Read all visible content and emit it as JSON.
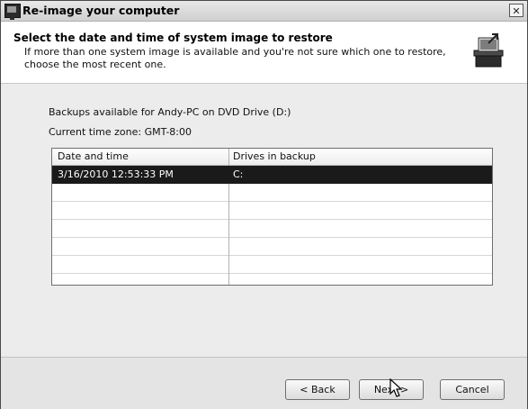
{
  "window": {
    "title": "Re-image your computer",
    "close_glyph": "✕"
  },
  "header": {
    "heading": "Select the date and time of system image to restore",
    "subheading": "If more than one system image is available and you're not sure which one to restore, choose the most recent one."
  },
  "content": {
    "backups_label": "Backups available for Andy-PC on DVD Drive (D:)",
    "timezone_label": "Current time zone: GMT-8:00",
    "columns": [
      "Date and time",
      "Drives in backup"
    ],
    "rows": [
      {
        "date": "3/16/2010 12:53:33 PM",
        "drives": "C:",
        "selected": true
      }
    ]
  },
  "footer": {
    "back_label": "< Back",
    "next_label": "Next >",
    "cancel_label": "Cancel"
  },
  "colors": {
    "selection": "#1a1a1a",
    "dialog_bg": "#ececec"
  }
}
